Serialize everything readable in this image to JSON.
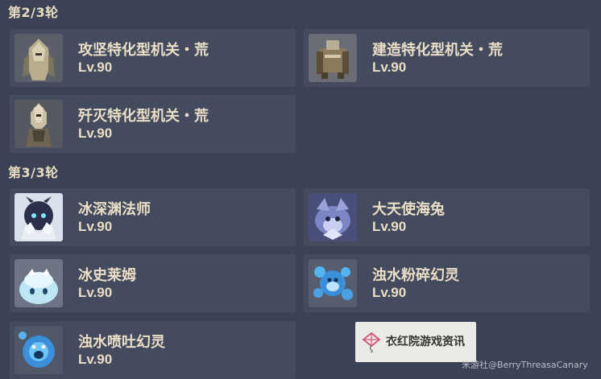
{
  "rounds": [
    {
      "header": "第2/3轮",
      "enemies": [
        {
          "name": "攻坚特化型机关・荒",
          "level": "Lv.90",
          "icon": "ruin-guard-icon"
        },
        {
          "name": "建造特化型机关・荒",
          "level": "Lv.90",
          "icon": "ruin-builder-icon"
        },
        {
          "name": "歼灭特化型机关・荒",
          "level": "Lv.90",
          "icon": "ruin-destroyer-icon"
        }
      ]
    },
    {
      "header": "第3/3轮",
      "enemies": [
        {
          "name": "冰深渊法师",
          "level": "Lv.90",
          "icon": "cryo-abyss-mage-icon"
        },
        {
          "name": "大天使海兔",
          "level": "Lv.90",
          "icon": "sea-hare-icon"
        },
        {
          "name": "冰史莱姆",
          "level": "Lv.90",
          "icon": "cryo-slime-icon"
        },
        {
          "name": "浊水粉碎幻灵",
          "level": "Lv.90",
          "icon": "hydro-mimic-icon"
        },
        {
          "name": "浊水喷吐幻灵",
          "level": "Lv.90",
          "icon": "hydro-spitter-icon"
        }
      ]
    }
  ],
  "watermark": {
    "text": "衣红院游戏资讯",
    "icon": "kite-icon"
  },
  "credit": "米游社@BerryThreasaCanary",
  "colors": {
    "background": "#3b4255",
    "card": "#444b5f",
    "text": "#eadfc6"
  }
}
